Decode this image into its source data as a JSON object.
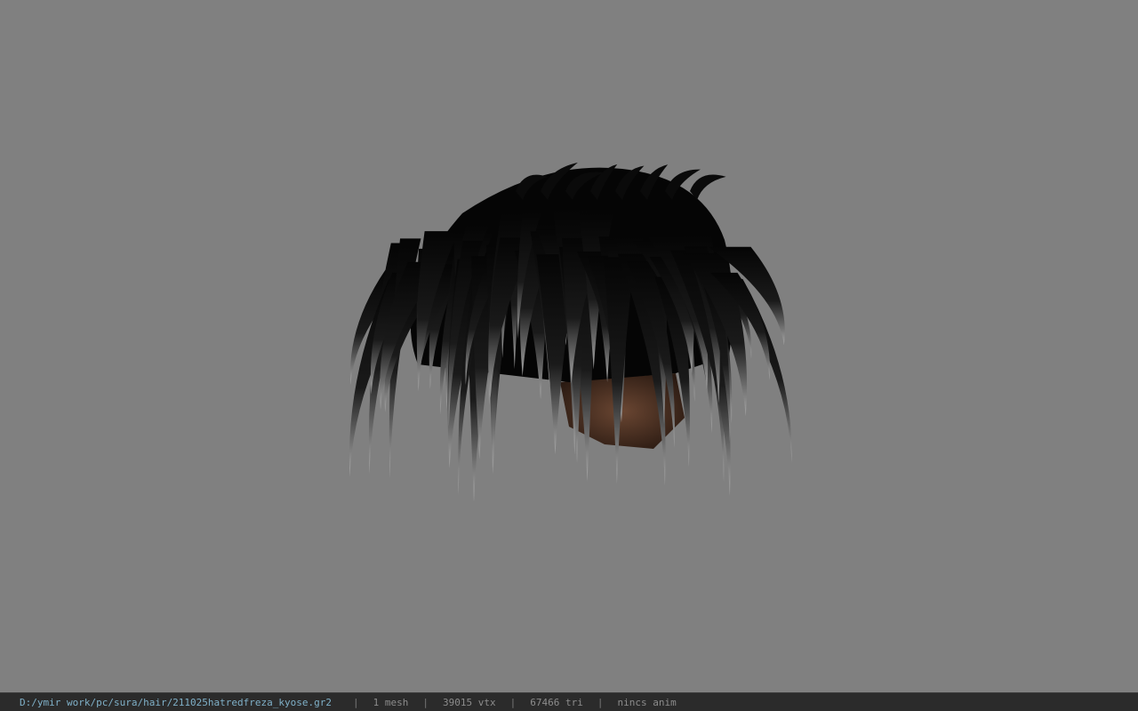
{
  "viewer": {
    "background": "#808080",
    "model_icon": "hair-mesh"
  },
  "status": {
    "file_path": "D:/ymir work/pc/sura/hair/211025hatredfreza_kyose.gr2",
    "separator": "|",
    "mesh": "1 mesh",
    "vertices": "39015 vtx",
    "triangles": "67466 tri",
    "animation": "nincs anim"
  }
}
